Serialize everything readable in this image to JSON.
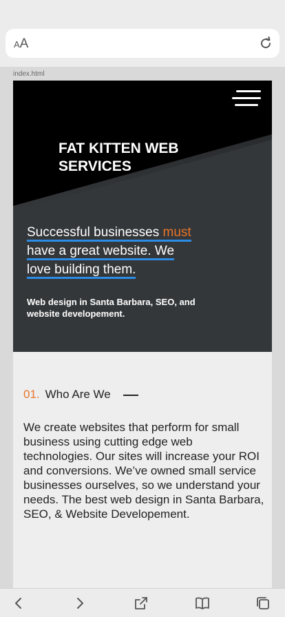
{
  "browser": {
    "text_size_small": "A",
    "text_size_large": "A",
    "reload_icon": "reload-icon"
  },
  "page": {
    "filename": "index.html"
  },
  "hero": {
    "brand": "FAT KITTEN WEB SERVICES",
    "tagline_lines": [
      {
        "pre": "Successful businesses ",
        "accent": "must"
      },
      {
        "pre": "have a great website.  We"
      },
      {
        "pre": "love building them."
      }
    ],
    "subtitle": "Web design in Santa Barbara, SEO, and website developement.",
    "menu_icon": "hamburger-menu-icon"
  },
  "about": {
    "number": "01.",
    "heading": "Who Are We",
    "body": "We create websites that perform for small business using cutting edge web technologies.  Our sites will increase your ROI and conversions.  We’ve owned small service businesses ourselves, so we understand your needs.  The best web design in Santa Barbara, SEO, & Website Developement."
  },
  "toolbar": {
    "icons": [
      "back-icon",
      "forward-icon",
      "share-icon",
      "bookmarks-icon",
      "tabs-icon"
    ]
  },
  "colors": {
    "accent": "#e8742a",
    "underline": "#2b8de6",
    "hero_bg": "#34373a",
    "hero_dark": "#000000"
  }
}
